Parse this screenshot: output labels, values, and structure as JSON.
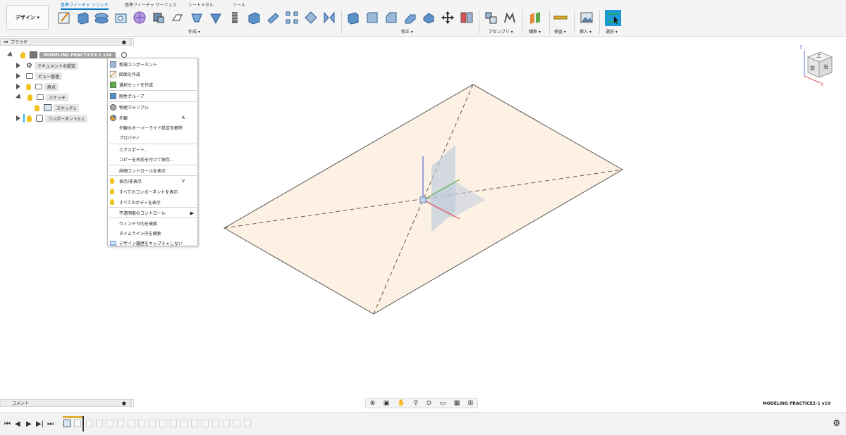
{
  "tabs": [
    "基準フィーチャ ソリッド",
    "基準フィーチャ サーフェス",
    "シートメタル",
    "ツール"
  ],
  "workspace": {
    "label": "デザイン ▾"
  },
  "toolbar_groups": {
    "create": "作成 ▾",
    "modify": "修正 ▾",
    "assemble": "アセンブリ ▾",
    "construct": "構築 ▾",
    "inspect": "検査 ▾",
    "insert": "挿入 ▾",
    "select": "選択 ▾"
  },
  "toolbar_icons": [
    "sketch-icon",
    "extrude-icon",
    "revolve-icon",
    "hole-icon",
    "pattern-icon",
    "new-body-icon",
    "mirror-icon",
    "loft-icon",
    "shell-icon",
    "thread-icon",
    "box-icon",
    "cylinder-icon",
    "pattern-tool-icon",
    "combine-icon",
    "press-pull-icon",
    "fillet-icon",
    "chamfer-icon",
    "split-icon",
    "move-icon",
    "align-icon",
    "joint-icon",
    "rigid-group-icon",
    "plane-icon",
    "measure-icon",
    "insert-image-icon",
    "select-icon"
  ],
  "browser": {
    "title": "ブラウザ",
    "root": "MODELING PRACTICE2-1 v10",
    "items": [
      "ドキュメントの設定",
      "ビュー管理",
      "原点",
      "スケッチ",
      "スケッチ1",
      "コンポーネント1:1"
    ]
  },
  "context_menu": [
    "新規コンポーネント",
    "図面を作成",
    "選択セットを作成",
    "剛性グループ",
    "物理マテリアル",
    "外観",
    "外観のオーバーライド設定を解除",
    "プロパティ",
    "エクスポート...",
    "コピーを名前を付けて保存...",
    "詳細コントロールを表示",
    "表示/非表示",
    "すべてのコンポーネントを表示",
    "すべてのボディを表示",
    "不透明度のコントロール",
    "ウィンドウ内を検索",
    "タイムライン内を検索",
    "デザイン履歴をキャプチャしない"
  ],
  "context_shortcuts": {
    "appearance": "A",
    "show_hide": "V"
  },
  "viewcube": {
    "top": "上",
    "front": "前",
    "right": "右",
    "x": "X",
    "z": "Z"
  },
  "comments": {
    "title": "コメント"
  },
  "status_doc": "MODELING PRACTICE2-1 v10",
  "colors": {
    "accent": "#0a7ac8",
    "plane": "#fdf1e4",
    "menu_border": "#b9b9b9"
  }
}
